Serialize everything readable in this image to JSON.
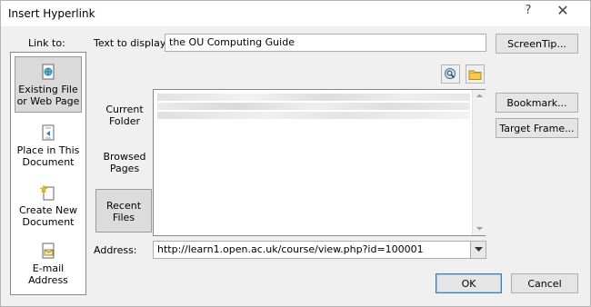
{
  "window": {
    "title": "Insert Hyperlink",
    "help_glyph": "?",
    "close_glyph": "✕"
  },
  "link_to": {
    "heading": "Link to:",
    "items": [
      {
        "label_lines": [
          "Existing File",
          "or Web Page"
        ],
        "icon": "existing-file-icon",
        "active": true
      },
      {
        "label_lines": [
          "Place in This",
          "Document"
        ],
        "icon": "place-in-document-icon",
        "active": false
      },
      {
        "label_lines": [
          "Create New",
          "Document"
        ],
        "icon": "create-new-document-icon",
        "active": false
      },
      {
        "label_lines": [
          "E-mail",
          "Address"
        ],
        "icon": "email-icon",
        "active": false
      }
    ]
  },
  "text_to_display": {
    "label": "Text to display:",
    "value": "the OU Computing Guide"
  },
  "screentip_button": "ScreenTip...",
  "look_in_tabs": [
    {
      "label_lines": [
        "Current",
        "Folder"
      ],
      "active": false
    },
    {
      "label_lines": [
        "Browsed",
        "Pages"
      ],
      "active": false
    },
    {
      "label_lines": [
        "Recent",
        "Files"
      ],
      "active": true
    }
  ],
  "bookmark_button": "Bookmark...",
  "target_frame_button": "Target Frame...",
  "address": {
    "label": "Address:",
    "value": "http://learn1.open.ac.uk/course/view.php?id=100001"
  },
  "ok_button": "OK",
  "cancel_button": "Cancel",
  "colors": {
    "dialog_bg": "#f0f0f0",
    "accent_border": "#3c7fb1"
  }
}
